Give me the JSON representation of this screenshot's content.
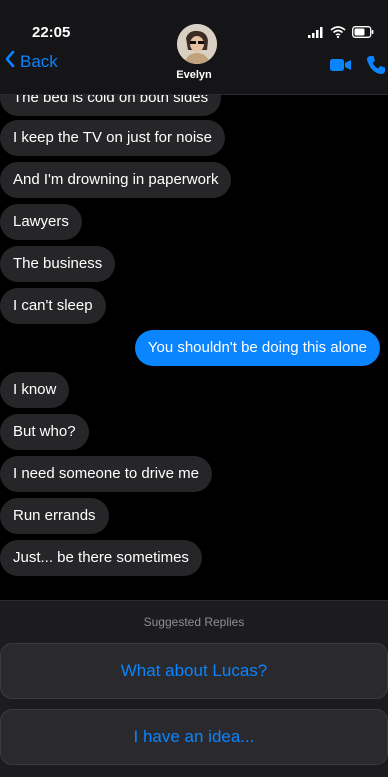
{
  "status_bar": {
    "time": "22:05"
  },
  "header": {
    "back_label": "Back",
    "contact_name": "Evelyn",
    "accent_color": "#0a84ff"
  },
  "messages": [
    {
      "direction": "incoming",
      "text": "The bed is cold on both sides"
    },
    {
      "direction": "incoming",
      "text": "I keep the TV on just for noise"
    },
    {
      "direction": "incoming",
      "text": "And I'm drowning in paperwork"
    },
    {
      "direction": "incoming",
      "text": "Lawyers"
    },
    {
      "direction": "incoming",
      "text": "The business"
    },
    {
      "direction": "incoming",
      "text": "I can't sleep"
    },
    {
      "direction": "outgoing",
      "text": "You shouldn't be doing this alone"
    },
    {
      "direction": "incoming",
      "text": "I know"
    },
    {
      "direction": "incoming",
      "text": "But who?"
    },
    {
      "direction": "incoming",
      "text": "I need someone to drive me"
    },
    {
      "direction": "incoming",
      "text": "Run errands"
    },
    {
      "direction": "incoming",
      "text": "Just... be there sometimes"
    }
  ],
  "suggestions": {
    "title": "Suggested Replies",
    "options": [
      "What about Lucas?",
      "I have an idea..."
    ]
  },
  "icons": [
    "signal-icon",
    "wifi-icon",
    "battery-icon",
    "chevron-left-icon",
    "video-call-icon",
    "phone-icon"
  ]
}
